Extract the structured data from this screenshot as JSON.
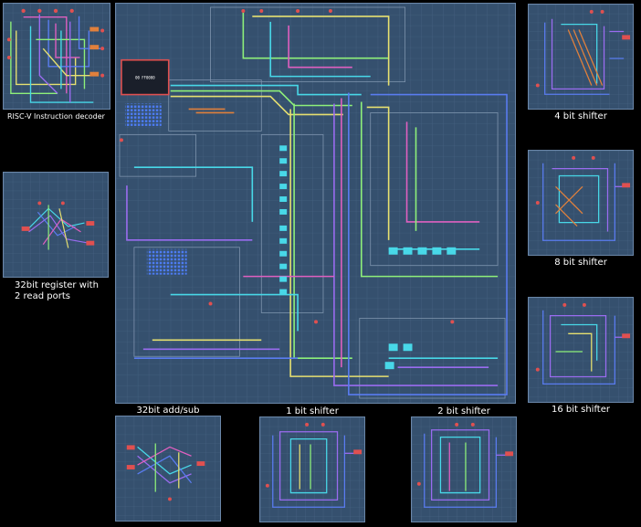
{
  "labels": {
    "decoder": "RISC-V Instruction decoder",
    "register_line1": "32bit register with",
    "register_line2": "2 read ports",
    "addsub": "32bit add/sub",
    "shift1": "1 bit shifter",
    "shift2": "2 bit shifter",
    "shift4": "4 bit shifter",
    "shift8": "8 bit shifter",
    "shift16": "16 bit shifter",
    "main_display": "00 FF0000"
  },
  "colors": {
    "background": "#000000",
    "panel": "#35506e",
    "grid": "#4a6786",
    "wire_cyan": "#48d8e8",
    "wire_purple": "#9a6cf0",
    "wire_blue": "#5a7cf0",
    "wire_green": "#8ef07a",
    "wire_yellow": "#e6e070",
    "wire_pink": "#e060c0",
    "wire_orange": "#e0803c",
    "pin_red": "#e05050"
  }
}
